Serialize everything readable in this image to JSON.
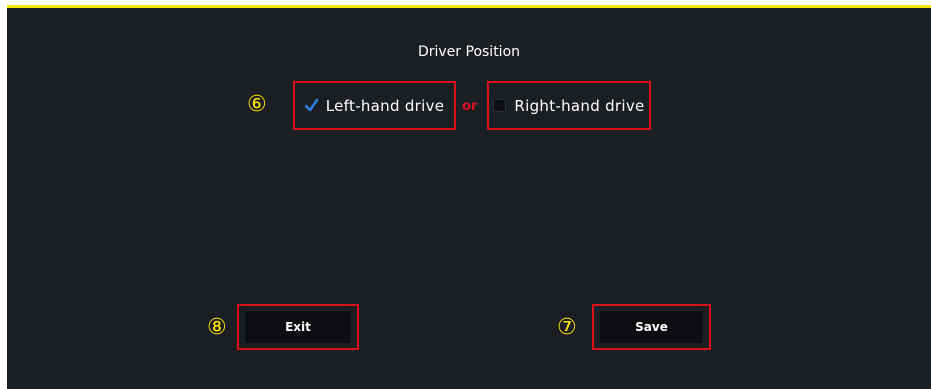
{
  "screen": {
    "title": "Driver Position"
  },
  "options": [
    {
      "label": "Left-hand drive",
      "checked": true
    },
    {
      "label": "Right-hand drive",
      "checked": false
    }
  ],
  "separator": "or",
  "callouts": {
    "options": "⑥",
    "save": "⑦",
    "exit": "⑧"
  },
  "buttons": {
    "exit": "Exit",
    "save": "Save"
  },
  "colors": {
    "accent_yellow": "#f2e600",
    "callout_red": "#d8121c",
    "check_blue": "#2f7fe0"
  }
}
